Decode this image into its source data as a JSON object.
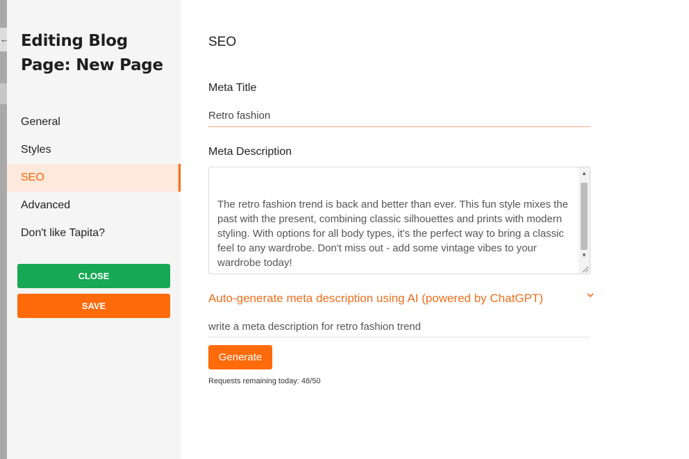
{
  "edge": {
    "back_glyph": "←"
  },
  "sidebar": {
    "title": "Editing Blog Page: New Page",
    "nav": [
      {
        "label": "General"
      },
      {
        "label": "Styles"
      },
      {
        "label": "SEO"
      },
      {
        "label": "Advanced"
      },
      {
        "label": "Don't like Tapita?"
      }
    ],
    "active_item": "SEO",
    "close_label": "CLOSE",
    "save_label": "SAVE"
  },
  "main": {
    "section_title": "SEO",
    "meta_title_label": "Meta Title",
    "meta_title_value": "Retro fashion",
    "meta_description_label": "Meta Description",
    "meta_description_value": "The retro fashion trend is back and better than ever. This fun style mixes the past with the present, combining classic silhouettes and prints with modern styling. With options for all body types, it's the perfect way to bring a classic feel to any wardrobe. Don't miss out - add some vintage vibes to your wardrobe today!",
    "ai_toggle_label": "Auto-generate meta description using AI (powered by ChatGPT)",
    "ai_prompt_value": "write a meta description for retro fashion trend",
    "generate_label": "Generate",
    "requests_remaining": "Requests remaining today: 48/50"
  },
  "colors": {
    "accent": "#ff6600",
    "close_button": "#16a853",
    "save_button": "#ff6a0a",
    "active_nav_bg": "#ffe8dc"
  },
  "icons": {
    "back": "back-arrow-icon",
    "ai_toggle": "chevron-down-icon",
    "scroll_up": "scroll-up-arrow-icon",
    "scroll_down": "scroll-down-arrow-icon",
    "resize": "resize-grip-icon"
  }
}
